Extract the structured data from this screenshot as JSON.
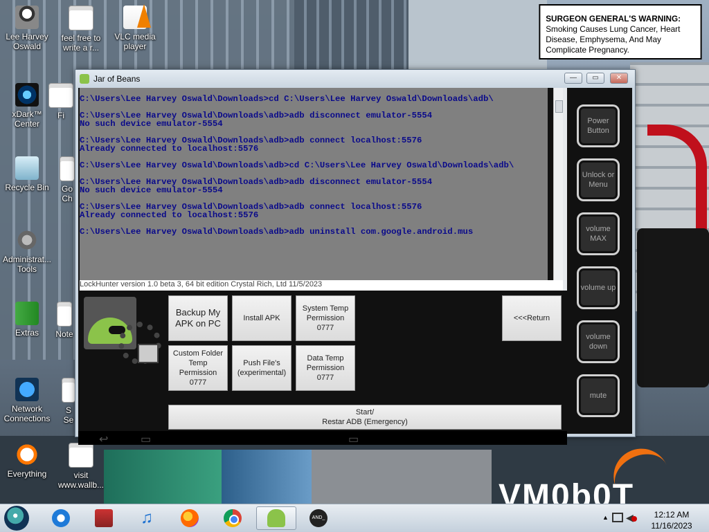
{
  "warning": {
    "heading": "SURGEON GENERAL'S WARNING:",
    "text": "Smoking Causes Lung Cancer, Heart Disease, Emphysema, And May Complicate Pregnancy."
  },
  "desktop_icons": [
    {
      "label": "Lee Harvey Oswald",
      "icon": "doll-icon"
    },
    {
      "label": "feel free to write a r...",
      "icon": "document-icon"
    },
    {
      "label": "VLC media player",
      "icon": "vlc-icon"
    },
    {
      "label": "xDark™ Center",
      "icon": "xdark-icon"
    },
    {
      "label": "Fi",
      "icon": "document-icon"
    },
    {
      "label": "Recycle Bin",
      "icon": "recycle-bin-icon"
    },
    {
      "label": "Go Ch",
      "icon": "chrome-icon"
    },
    {
      "label": "Administrat... Tools",
      "icon": "gear-icon"
    },
    {
      "label": "Extras",
      "icon": "folder-icon"
    },
    {
      "label": "Note",
      "icon": "document-icon"
    },
    {
      "label": "Network Connections",
      "icon": "network-icon"
    },
    {
      "label": "S Se",
      "icon": "document-icon"
    },
    {
      "label": "Everything",
      "icon": "search-icon"
    },
    {
      "label": "visit www.wallb...",
      "icon": "document-icon"
    }
  ],
  "window": {
    "title": "Jar of Beans",
    "minimize_label": "—",
    "maximize_label": "▭",
    "close_label": "✕"
  },
  "console": {
    "lines": [
      "C:\\Users\\Lee Harvey Oswald\\Downloads>cd C:\\Users\\Lee Harvey Oswald\\Downloads\\adb\\",
      "",
      "C:\\Users\\Lee Harvey Oswald\\Downloads\\adb>adb disconnect emulator-5554",
      "No such device emulator-5554",
      "",
      "C:\\Users\\Lee Harvey Oswald\\Downloads\\adb>adb connect localhost:5576",
      "Already connected to localhost:5576",
      "",
      "C:\\Users\\Lee Harvey Oswald\\Downloads\\adb>cd C:\\Users\\Lee Harvey Oswald\\Downloads\\adb\\",
      "",
      "C:\\Users\\Lee Harvey Oswald\\Downloads\\adb>adb disconnect emulator-5554",
      "No such device emulator-5554",
      "",
      "C:\\Users\\Lee Harvey Oswald\\Downloads\\adb>adb connect localhost:5576",
      "Already connected to localhost:5576",
      "",
      "C:\\Users\\Lee Harvey Oswald\\Downloads\\adb>adb uninstall com.google.android.mus"
    ],
    "behind_text": "LockHunter version 1.0 beta 3, 64 bit edition          Crystal Rich, Ltd          11/5/2023"
  },
  "buttons": {
    "backup_apk": "Backup My APK on PC",
    "install_apk": "Install APK",
    "system_temp": "System Temp Permission 0777",
    "custom_folder": "Custom Folder Temp Permission 0777",
    "push_files": "Push File's (experimental)",
    "data_temp": "Data Temp Permission 0777",
    "return": "<<<Return",
    "start_line1": "Start/",
    "start_line2": "Restar ADB (Emergency)"
  },
  "side_buttons": {
    "power": "Power Button",
    "unlock": "Unlock or Menu",
    "volume_max": "volume MAX",
    "volume_up": "volume up",
    "volume_down": "volume down",
    "mute": "mute"
  },
  "wallpaper_brand": "VM0b0T",
  "taskbar": {
    "items": [
      "start-orb-icon",
      "ie-icon",
      "store-icon",
      "music-icon",
      "firefox-icon",
      "chrome-icon",
      "android-icon",
      "android-terminal-icon"
    ],
    "time": "12:12 AM",
    "date": "11/16/2023"
  }
}
